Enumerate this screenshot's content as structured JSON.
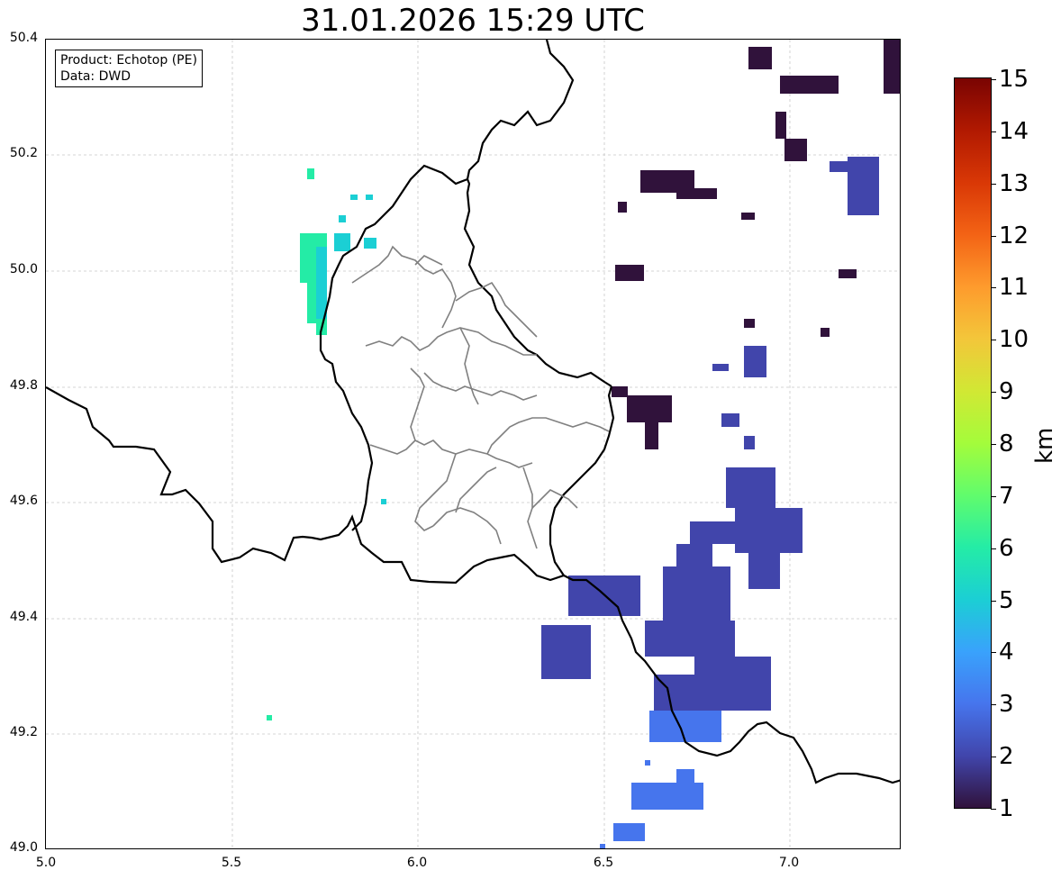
{
  "title": "31.01.2026 15:29 UTC",
  "info": {
    "product": "Product: Echotop (PE)",
    "data": "Data: DWD"
  },
  "axes": {
    "x_ticks": [
      "5.0",
      "5.5",
      "6.0",
      "6.5",
      "7.0"
    ],
    "y_ticks": [
      "50.4",
      "50.2",
      "50.0",
      "49.8",
      "49.6",
      "49.4",
      "49.2",
      "49.0"
    ]
  },
  "colorbar": {
    "unit": "km",
    "labels": [
      "15",
      "14",
      "13",
      "12",
      "11",
      "10",
      "9",
      "8",
      "7",
      "6",
      "5",
      "4",
      "3",
      "2",
      "1"
    ],
    "colors": [
      "#30123b",
      "#4145ab",
      "#4675ed",
      "#39a2fc",
      "#1bcfd4",
      "#24eca6",
      "#61fc6c",
      "#a4fc3b",
      "#d1e834",
      "#f3c63a",
      "#fe9b2d",
      "#f36315",
      "#d93806",
      "#b11901",
      "#7a0402"
    ]
  },
  "map": {
    "lon_range": [
      5.0,
      7.3
    ],
    "lat_range": [
      49.0,
      50.4
    ],
    "gridlines": true
  }
}
